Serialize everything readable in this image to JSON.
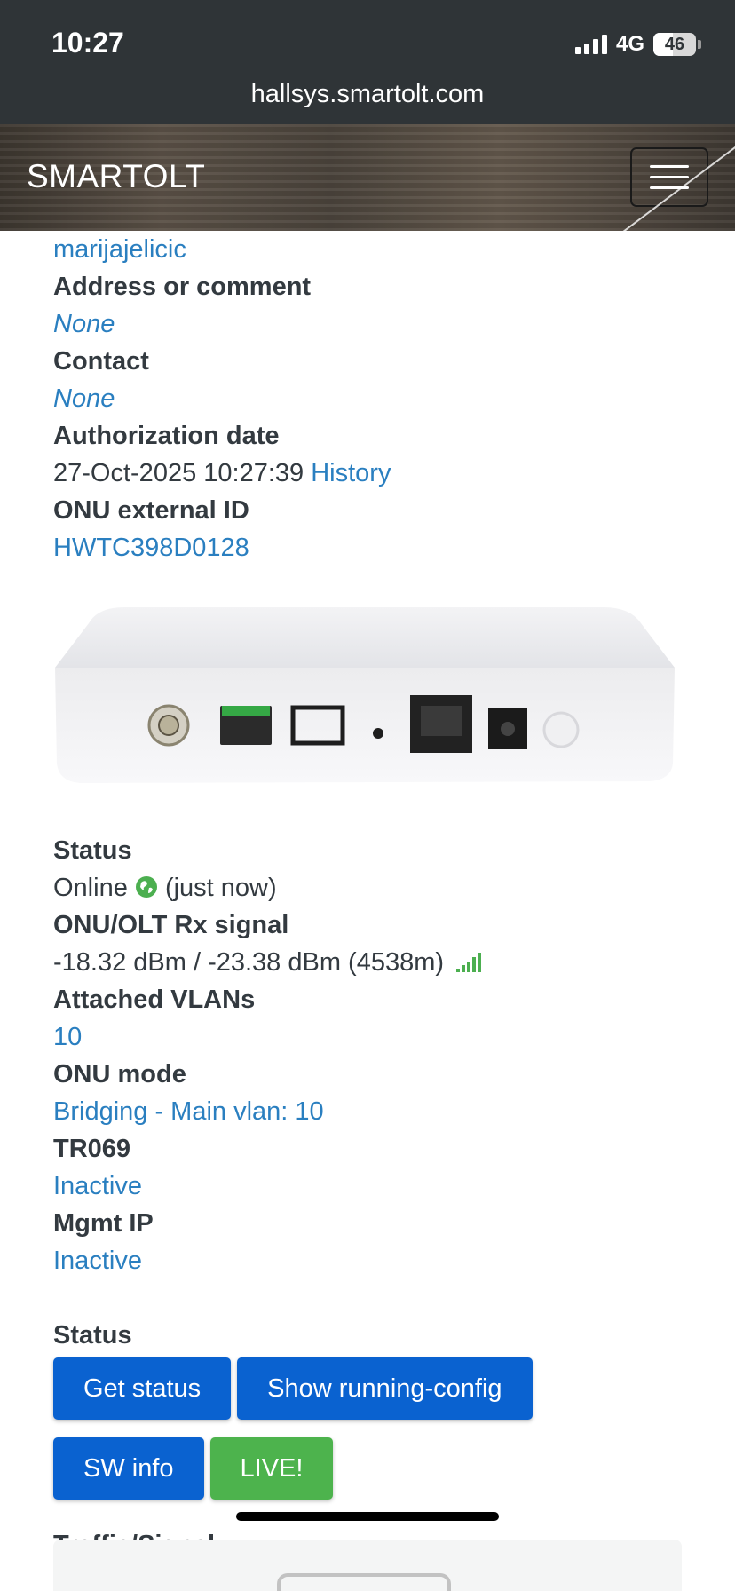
{
  "status_bar": {
    "time": "10:27",
    "network": "4G",
    "battery": "46"
  },
  "browser": {
    "url": "hallsys.smartolt.com"
  },
  "navbar": {
    "brand": "SMARTOLT"
  },
  "details": {
    "username": "marijajelicic",
    "address_label": "Address or comment",
    "address_value": "None",
    "contact_label": "Contact",
    "contact_value": "None",
    "auth_date_label": "Authorization date",
    "auth_date_value": "27-Oct-2025 10:27:39",
    "history_link": "History",
    "external_id_label": "ONU external ID",
    "external_id_value": "HWTC398D0128"
  },
  "status_info": {
    "status_label": "Status",
    "status_value": "Online",
    "status_time": "(just now)",
    "signal_label": "ONU/OLT Rx signal",
    "signal_value": "-18.32 dBm / -23.38 dBm (4538m)",
    "vlans_label": "Attached VLANs",
    "vlans_value": "10",
    "mode_label": "ONU mode",
    "mode_value": "Bridging - Main vlan: 10",
    "tr069_label": "TR069",
    "tr069_value": "Inactive",
    "mgmt_label": "Mgmt IP",
    "mgmt_value": "Inactive"
  },
  "actions": {
    "section_label": "Status",
    "get_status": "Get status",
    "running_config": "Show running-config",
    "sw_info": "SW info",
    "live": "LIVE!"
  },
  "traffic": {
    "label": "Traffic/Signal"
  },
  "colors": {
    "link": "#2a7fc0",
    "primary_button": "#0a62d0",
    "success_button": "#4db34d",
    "online_icon": "#4caf50"
  },
  "icons": {
    "status_online": "globe-icon",
    "signal": "signal-bars-icon",
    "menu": "hamburger-icon"
  }
}
